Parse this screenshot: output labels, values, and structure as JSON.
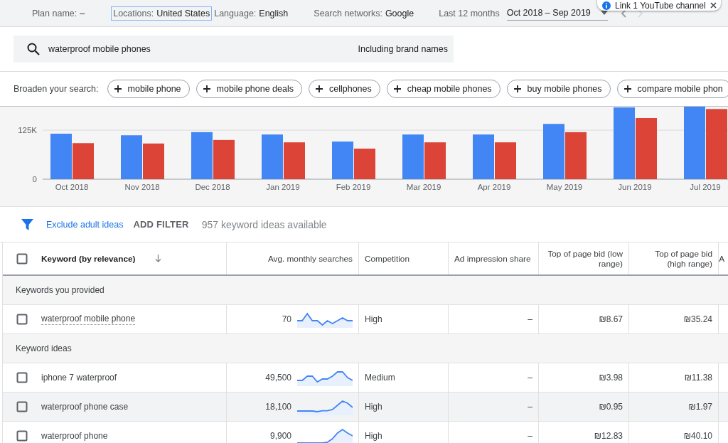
{
  "top_bar": {
    "plan_name": {
      "label": "Plan name:",
      "value": "–"
    },
    "filters": [
      {
        "label": "Locations:",
        "value": "United States",
        "selected": true
      },
      {
        "label": "Language:",
        "value": "English",
        "selected": false
      },
      {
        "label": "Search networks:",
        "value": "Google",
        "selected": false
      }
    ],
    "date_range": {
      "label": "Last 12 months",
      "value": "Oct 2018 – Sep 2019"
    }
  },
  "notification": {
    "text": "Link 1 YouTube channel"
  },
  "search": {
    "value": "waterproof mobile phones",
    "option": "Including brand names"
  },
  "broaden": {
    "label": "Broaden your search:",
    "chips": [
      "mobile phone",
      "mobile phone deals",
      "cellphones",
      "cheap mobile phones",
      "buy mobile phones",
      "compare mobile phon"
    ]
  },
  "chart": {
    "chart_data": {
      "type": "bar",
      "categories": [
        "Oct 2018",
        "Nov 2018",
        "Dec 2018",
        "Jan 2019",
        "Feb 2019",
        "Mar 2019",
        "Apr 2019",
        "May 2019",
        "Jun 2019",
        "Jul 2019"
      ],
      "series": [
        {
          "color": "#4285f4",
          "values": [
            116000,
            112000,
            120000,
            114000,
            96000,
            114000,
            114000,
            141000,
            183000,
            185000
          ]
        },
        {
          "color": "#db4437",
          "values": [
            92000,
            91000,
            100000,
            94000,
            78000,
            94000,
            94000,
            120000,
            156000,
            179000
          ]
        }
      ],
      "ylim": [
        0,
        185000
      ],
      "yticks": [
        {
          "value": 0,
          "label": "0"
        },
        {
          "value": 125000,
          "label": "125K"
        }
      ]
    }
  },
  "filter_bar": {
    "link": "Exclude adult ideas",
    "button": "ADD FILTER",
    "count": "957 keyword ideas available"
  },
  "table": {
    "header_checkbox": {
      "checked": false
    },
    "columns": [
      {
        "label": "Keyword (by relevance)",
        "sorted": true
      },
      {
        "label": "Avg. monthly searches",
        "sorted": false
      },
      {
        "label": "Competition",
        "sorted": false
      },
      {
        "label": "Ad impression share",
        "sorted": false
      },
      {
        "label": "Top of page bid (low range)",
        "sorted": false
      },
      {
        "label": "Top of page bid (high range)",
        "sorted": false
      },
      {
        "label": "A",
        "sorted": false
      }
    ],
    "groups": [
      {
        "title": "Keywords you provided",
        "kind": "provided",
        "rows": [
          {
            "keyword": "waterproof mobile phone",
            "searches": "70",
            "competition": "High",
            "impression_share": "–",
            "bid_low": "₪8.67",
            "bid_high": "₪35.24",
            "checked": false,
            "hovered": false
          }
        ]
      },
      {
        "title": "Keyword ideas",
        "kind": "ideas",
        "rows": [
          {
            "keyword": "iphone 7 waterproof",
            "searches": "49,500",
            "competition": "Medium",
            "impression_share": "–",
            "bid_low": "₪3.98",
            "bid_high": "₪11.38",
            "checked": false,
            "hovered": false
          },
          {
            "keyword": "waterproof phone case",
            "searches": "18,100",
            "competition": "High",
            "impression_share": "–",
            "bid_low": "₪0.95",
            "bid_high": "₪1.97",
            "checked": false,
            "hovered": true
          },
          {
            "keyword": "waterproof phone",
            "searches": "9,900",
            "competition": "High",
            "impression_share": "–",
            "bid_low": "₪12.83",
            "bid_high": "₪40.10",
            "checked": false,
            "hovered": false
          }
        ]
      }
    ]
  }
}
